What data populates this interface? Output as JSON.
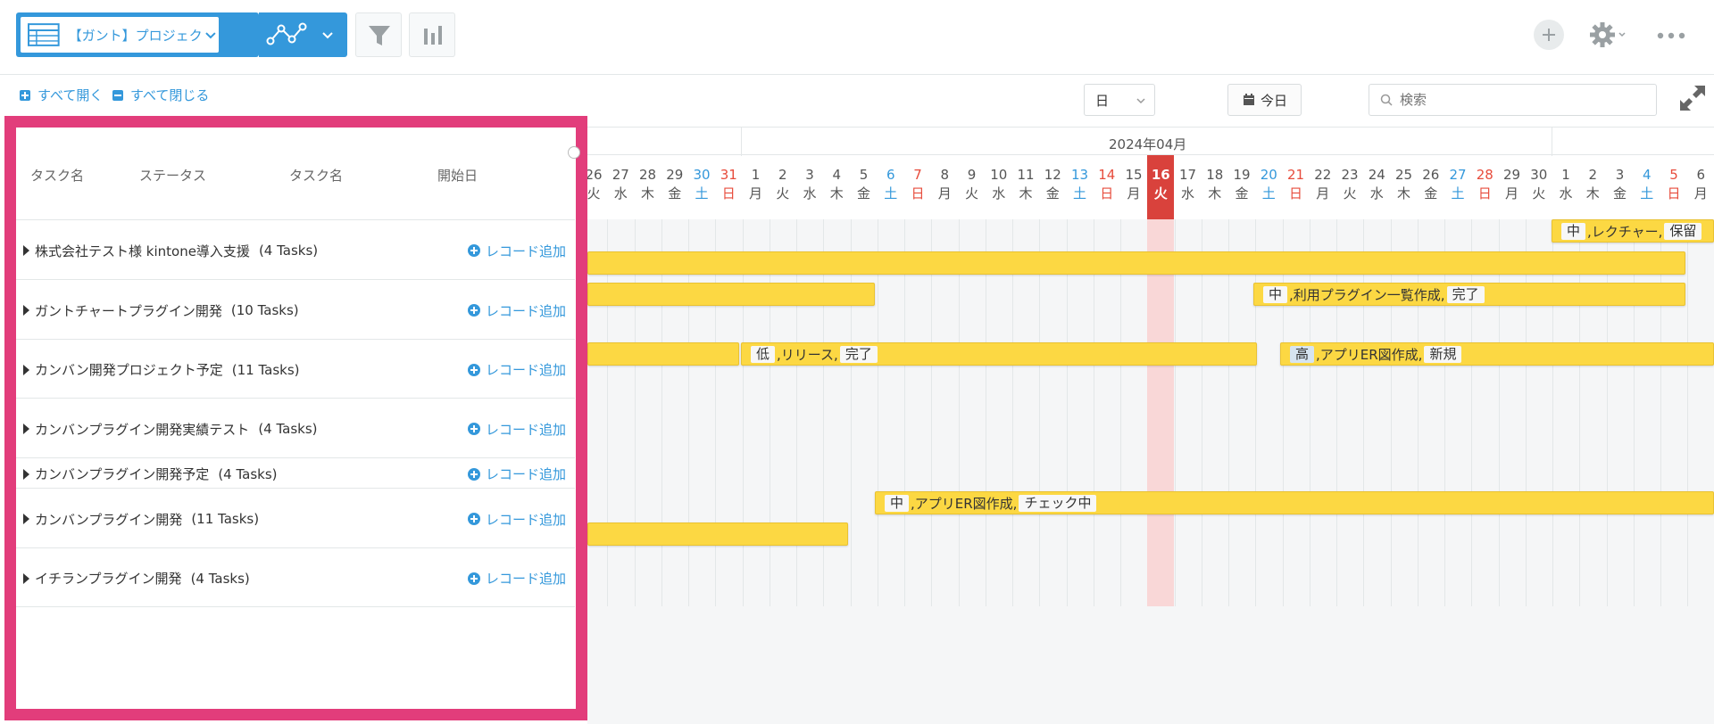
{
  "toolbar": {
    "view_name": "【ガント】プロジェク…",
    "icons": [
      "table-icon",
      "chevron-down-icon",
      "graph-icon",
      "filter-icon",
      "bar-chart-icon",
      "plus-icon",
      "gear-icon",
      "more-icon"
    ]
  },
  "controls": {
    "expand_all": "すべて開く",
    "collapse_all": "すべて閉じる",
    "scale": "日",
    "today": "今日",
    "search_placeholder": "検索"
  },
  "left_panel": {
    "headers": [
      "タスク名",
      "ステータス",
      "タスク名",
      "開始日"
    ],
    "add_label": "レコード追加",
    "groups": [
      {
        "name": "株式会社テスト様 kintone導入支援",
        "count": "(4 Tasks)"
      },
      {
        "name": "ガントチャートプラグイン開発",
        "count": "(10 Tasks)"
      },
      {
        "name": "カンバン開発プロジェクト予定",
        "count": "(11 Tasks)"
      },
      {
        "name": "カンバンプラグイン開発実績テスト",
        "count": "(4 Tasks)"
      },
      {
        "name": "カンバンプラグイン開発予定",
        "count": "(4 Tasks)"
      },
      {
        "name": "カンバンプラグイン開発",
        "count": "(11 Tasks)"
      },
      {
        "name": "イチランプラグイン開発",
        "count": "(4 Tasks)"
      }
    ]
  },
  "gantt": {
    "month": "2024年04月",
    "days": [
      {
        "d": "26",
        "w": "火",
        "t": ""
      },
      {
        "d": "27",
        "w": "水",
        "t": ""
      },
      {
        "d": "28",
        "w": "木",
        "t": ""
      },
      {
        "d": "29",
        "w": "金",
        "t": ""
      },
      {
        "d": "30",
        "w": "土",
        "t": "sat"
      },
      {
        "d": "31",
        "w": "日",
        "t": "sun"
      },
      {
        "d": "1",
        "w": "月",
        "t": ""
      },
      {
        "d": "2",
        "w": "火",
        "t": ""
      },
      {
        "d": "3",
        "w": "水",
        "t": ""
      },
      {
        "d": "4",
        "w": "木",
        "t": ""
      },
      {
        "d": "5",
        "w": "金",
        "t": ""
      },
      {
        "d": "6",
        "w": "土",
        "t": "sat"
      },
      {
        "d": "7",
        "w": "日",
        "t": "sun"
      },
      {
        "d": "8",
        "w": "月",
        "t": ""
      },
      {
        "d": "9",
        "w": "火",
        "t": ""
      },
      {
        "d": "10",
        "w": "水",
        "t": ""
      },
      {
        "d": "11",
        "w": "木",
        "t": ""
      },
      {
        "d": "12",
        "w": "金",
        "t": ""
      },
      {
        "d": "13",
        "w": "土",
        "t": "sat"
      },
      {
        "d": "14",
        "w": "日",
        "t": "sun"
      },
      {
        "d": "15",
        "w": "月",
        "t": ""
      },
      {
        "d": "16",
        "w": "火",
        "t": "today"
      },
      {
        "d": "17",
        "w": "水",
        "t": ""
      },
      {
        "d": "18",
        "w": "木",
        "t": ""
      },
      {
        "d": "19",
        "w": "金",
        "t": ""
      },
      {
        "d": "20",
        "w": "土",
        "t": "sat"
      },
      {
        "d": "21",
        "w": "日",
        "t": "sun"
      },
      {
        "d": "22",
        "w": "月",
        "t": ""
      },
      {
        "d": "23",
        "w": "火",
        "t": ""
      },
      {
        "d": "24",
        "w": "水",
        "t": ""
      },
      {
        "d": "25",
        "w": "木",
        "t": ""
      },
      {
        "d": "26",
        "w": "金",
        "t": ""
      },
      {
        "d": "27",
        "w": "土",
        "t": "sat"
      },
      {
        "d": "28",
        "w": "日",
        "t": "sun"
      },
      {
        "d": "29",
        "w": "月",
        "t": ""
      },
      {
        "d": "30",
        "w": "火",
        "t": ""
      },
      {
        "d": "1",
        "w": "水",
        "t": ""
      },
      {
        "d": "2",
        "w": "木",
        "t": ""
      },
      {
        "d": "3",
        "w": "金",
        "t": ""
      },
      {
        "d": "4",
        "w": "土",
        "t": "sat"
      },
      {
        "d": "5",
        "w": "日",
        "t": "sun"
      },
      {
        "d": "6",
        "w": "月",
        "t": ""
      }
    ],
    "bars": [
      {
        "tags": [
          "中",
          ",レクチャー,",
          "保留"
        ]
      },
      {
        "tags": []
      },
      {
        "tags": []
      },
      {
        "tags": [
          "中",
          ",利用プラグイン一覧作成,",
          "完了"
        ]
      },
      {
        "tags": []
      },
      {
        "tags": [
          "低",
          ",リリース,",
          "完了"
        ]
      },
      {
        "tags": [
          "高",
          ",アプリER図作成,",
          "新規"
        ]
      },
      {
        "tags": [
          "中",
          ",アプリER図作成,",
          "チェック中"
        ]
      },
      {
        "tags": []
      }
    ]
  }
}
